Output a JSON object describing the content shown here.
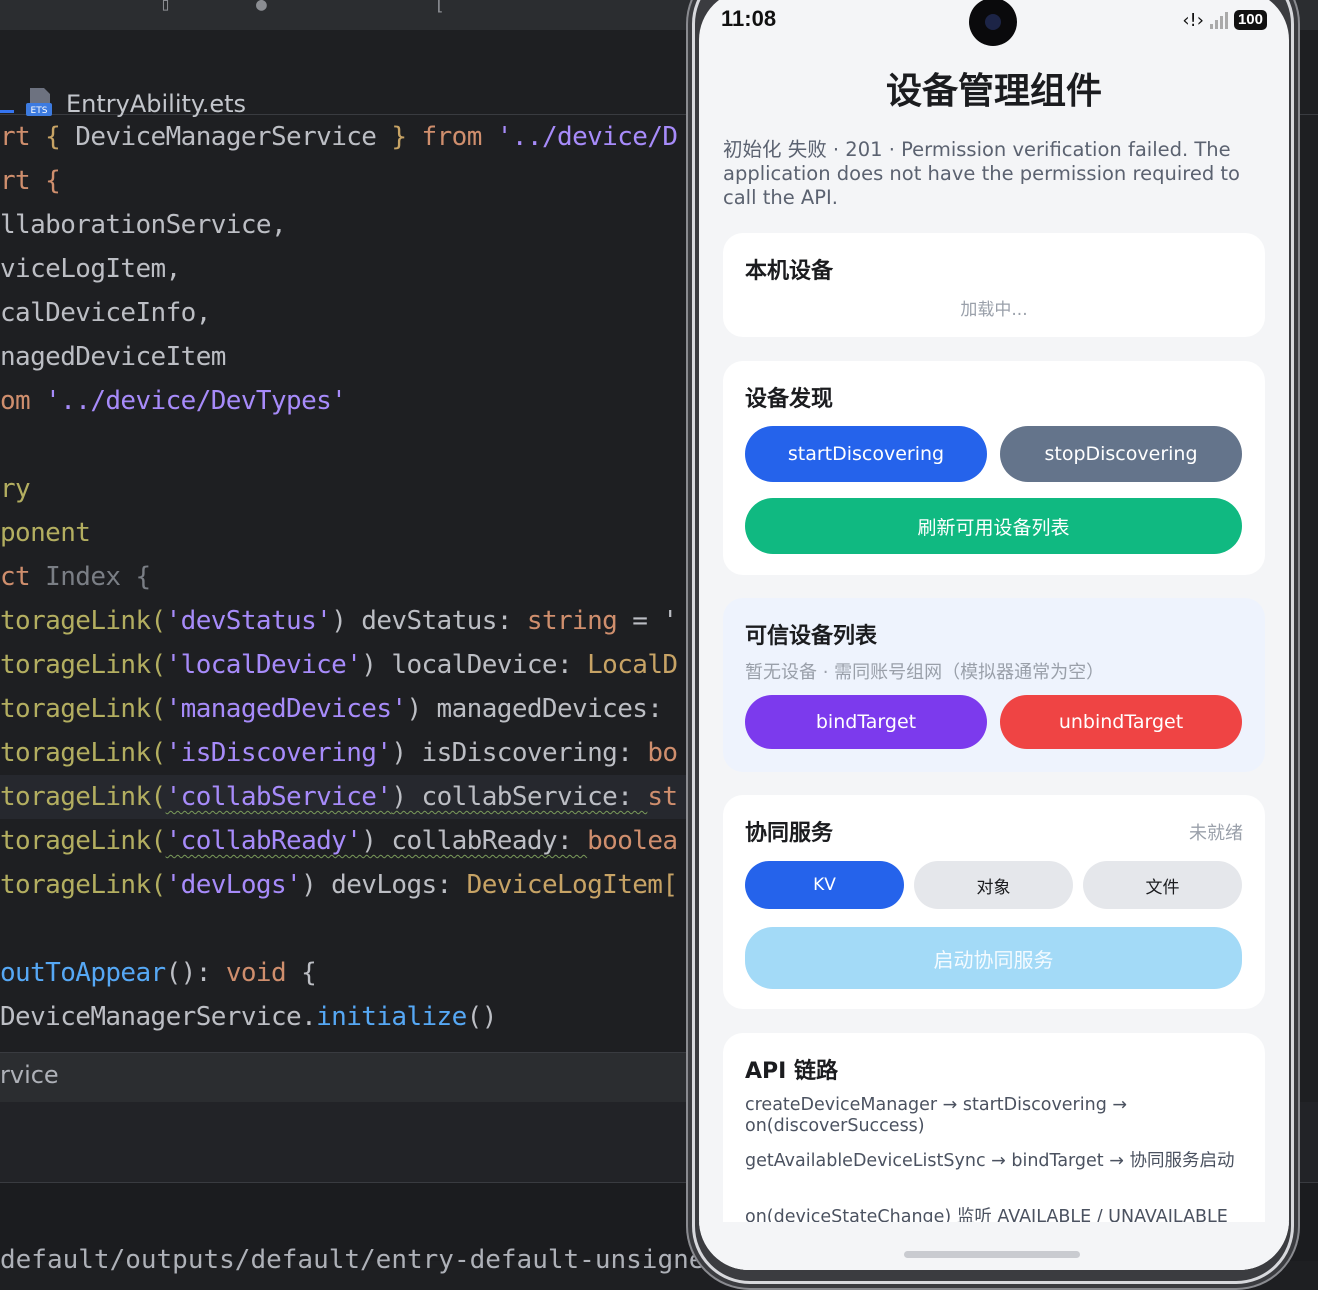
{
  "ide": {
    "file_tab": "EntryAbility.ets",
    "code_lines": [
      [
        "rt ",
        "{ ",
        "DeviceManagerService",
        " } ",
        "from",
        " '../device/D"
      ],
      [
        "rt {"
      ],
      [
        "llaborationService,"
      ],
      [
        "viceLogItem,"
      ],
      [
        "calDeviceInfo,"
      ],
      [
        "nagedDeviceItem"
      ],
      [
        "om",
        " '../device/DevTypes'"
      ],
      [
        ""
      ],
      [
        "ry"
      ],
      [
        "ponent"
      ],
      [
        "ct",
        " Index {"
      ],
      [
        "torageLink(",
        "'devStatus'",
        ") devStatus: ",
        "string",
        " = '"
      ],
      [
        "torageLink(",
        "'localDevice'",
        ") localDevice: ",
        "LocalD"
      ],
      [
        "torageLink(",
        "'managedDevices'",
        ") managedDevices:"
      ],
      [
        "torageLink(",
        "'isDiscovering'",
        ") isDiscovering: ",
        "bo"
      ],
      [
        "torageLink(",
        "'collabService'",
        ") collabService: ",
        "st"
      ],
      [
        "torageLink(",
        "'collabReady'",
        ") collabReady: ",
        "boolea"
      ],
      [
        "torageLink(",
        "'devLogs'",
        ") devLogs: ",
        "DeviceLogItem["
      ],
      [
        ""
      ],
      [
        "outToAppear",
        "(): ",
        "void",
        " {"
      ],
      [
        "DeviceManagerService.",
        "initialize",
        "()"
      ]
    ],
    "status_text": "rvice",
    "bottom_text": "default/outputs/default/entry-default-unsigned"
  },
  "phone": {
    "time": "11:08",
    "battery": "100",
    "app_title": "设备管理组件",
    "status_message": "初始化 失败 · 201 · Permission verification failed. The application does not have the permission required to call the API.",
    "local_device": {
      "title": "本机设备",
      "loading": "加载中..."
    },
    "discovery": {
      "title": "设备发现",
      "start_label": "startDiscovering",
      "stop_label": "stopDiscovering",
      "refresh_label": "刷新可用设备列表"
    },
    "trusted": {
      "title": "可信设备列表",
      "empty_hint": "暂无设备 · 需同账号组网（模拟器通常为空）",
      "bind_label": "bindTarget",
      "unbind_label": "unbindTarget"
    },
    "collab": {
      "title": "协同服务",
      "state": "未就绪",
      "tabs": [
        "KV",
        "对象",
        "文件"
      ],
      "start_label": "启动协同服务"
    },
    "api": {
      "title": "API 链路",
      "lines": [
        "createDeviceManager → startDiscovering → on(discoverSuccess)",
        "getAvailableDeviceListSync → bindTarget → 协同服务启动",
        "on(deviceStateChange) 监听 AVAILABLE / UNAVAILABLE"
      ]
    }
  },
  "colors": {
    "accent_blue": "#2563eb",
    "slate": "#64748b",
    "green": "#10b981",
    "purple": "#7c3aed",
    "red": "#ef4444"
  }
}
